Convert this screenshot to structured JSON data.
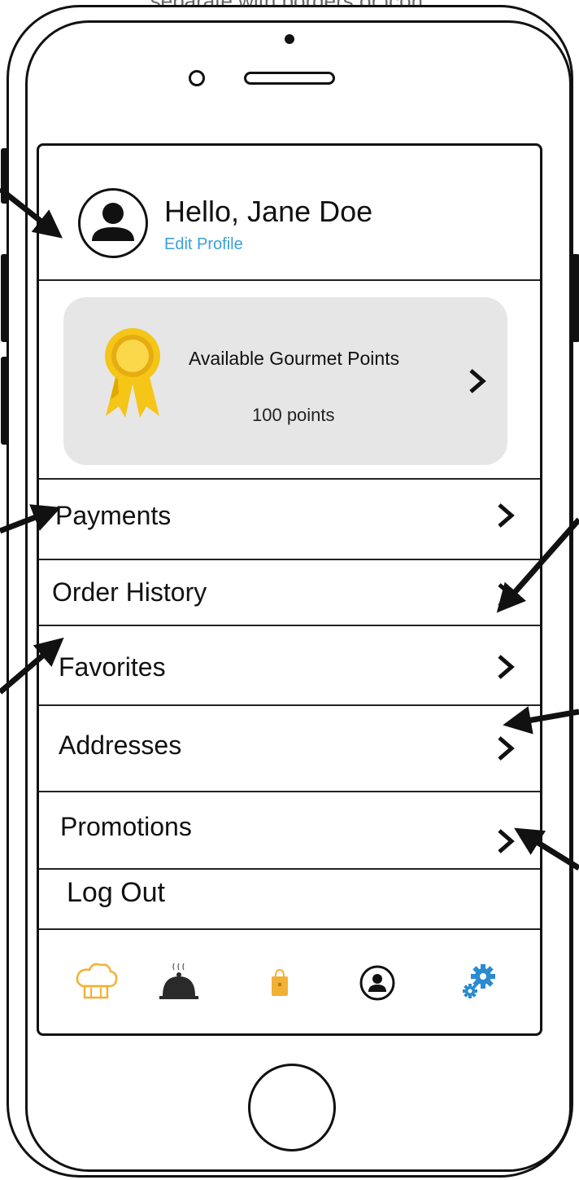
{
  "caption": "separate with borders or icon.",
  "profile": {
    "greeting": "Hello, Jane Doe",
    "edit_link": "Edit Profile"
  },
  "points": {
    "title": "Available Gourmet Points",
    "value": "100 points"
  },
  "menu": [
    {
      "label": "Payments"
    },
    {
      "label": "Order History"
    },
    {
      "label": "Favorites"
    },
    {
      "label": "Addresses"
    },
    {
      "label": "Promotions"
    }
  ],
  "logout_label": "Log Out",
  "tabs": [
    {
      "icon": "chef-hat-icon"
    },
    {
      "icon": "food-cloche-icon"
    },
    {
      "icon": "shopping-bag-icon"
    },
    {
      "icon": "profile-icon"
    },
    {
      "icon": "gear-icon"
    }
  ],
  "colors": {
    "link": "#3aa0d8",
    "card_bg": "#e6e6e6",
    "chef_hat": "#f2b134",
    "bag": "#f2b134",
    "gear": "#2a8bd0",
    "ribbon": "#f5c518"
  }
}
